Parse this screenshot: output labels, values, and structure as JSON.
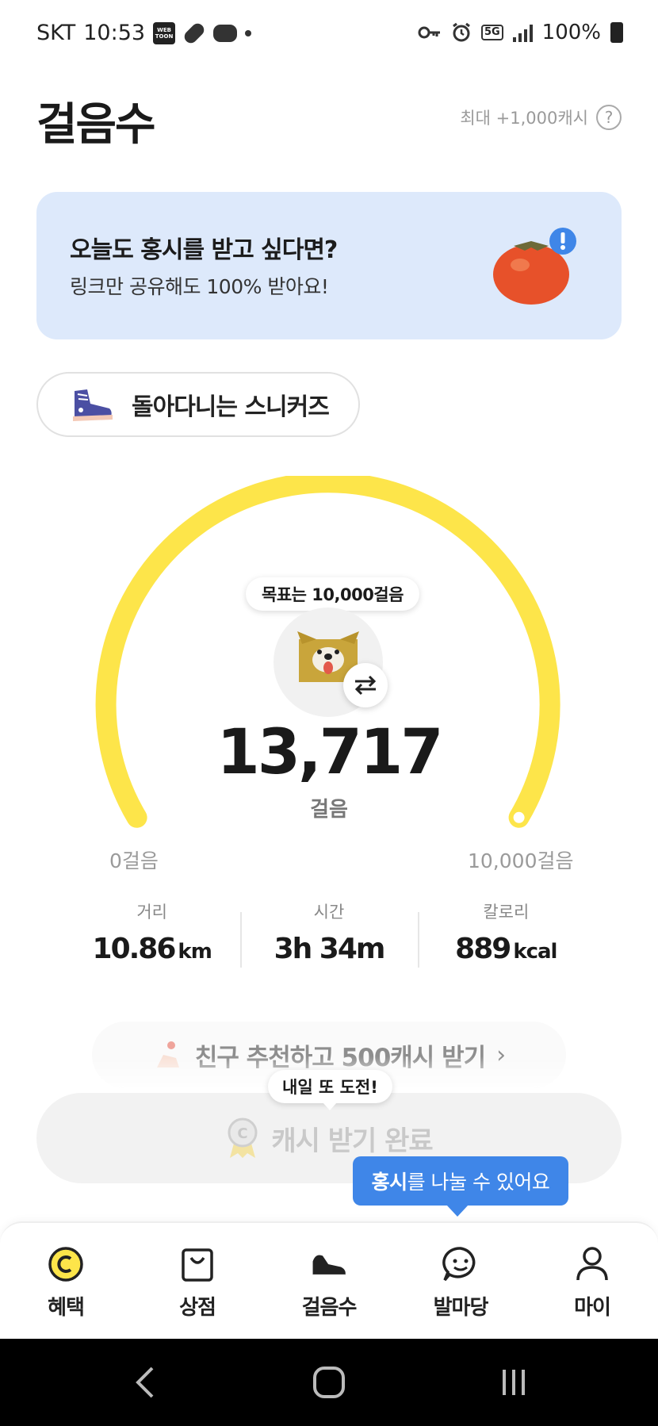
{
  "status_bar": {
    "carrier": "SKT",
    "time": "10:53",
    "webtoon_icon_text": "WEB TOON",
    "network": "5G",
    "battery": "100%"
  },
  "header": {
    "title": "걸음수",
    "max_cash": "최대 +1,000캐시",
    "help_glyph": "?"
  },
  "promo_banner": {
    "title": "오늘도 홍시를 받고 싶다면?",
    "subtitle": "링크만 공유해도 100% 받아요!"
  },
  "sneaker_chip": {
    "label": "돌아다니는 스니커즈"
  },
  "gauge": {
    "goal_bubble": "목표는 10,000걸음",
    "steps": "13,717",
    "unit": "걸음",
    "min_label": "0걸음",
    "max_label": "10,000걸음",
    "progress_fraction": 1.0,
    "color": "#fde54a"
  },
  "stats": [
    {
      "label": "거리",
      "value": "10.86",
      "unit": "km"
    },
    {
      "label": "시간",
      "value": "3h 34m",
      "unit": ""
    },
    {
      "label": "칼로리",
      "value": "889",
      "unit": "kcal"
    }
  ],
  "invite": {
    "label": "친구 추천하고 500캐시 받기"
  },
  "retry_bubble": "내일 또 도전!",
  "cash_button": {
    "label": "캐시 받기 완료"
  },
  "share_tooltip": {
    "bold": "홍시",
    "rest": "를 나눌 수 있어요"
  },
  "bottom_nav": [
    {
      "label": "혜택",
      "icon": "cash-coin-icon"
    },
    {
      "label": "상점",
      "icon": "shopping-bag-icon"
    },
    {
      "label": "걸음수",
      "icon": "sneaker-icon"
    },
    {
      "label": "발마당",
      "icon": "chat-smile-icon"
    },
    {
      "label": "마이",
      "icon": "person-icon"
    }
  ],
  "colors": {
    "accent_yellow": "#fde54a",
    "banner_blue": "#dde9fb",
    "tooltip_blue": "#3f86e8"
  }
}
